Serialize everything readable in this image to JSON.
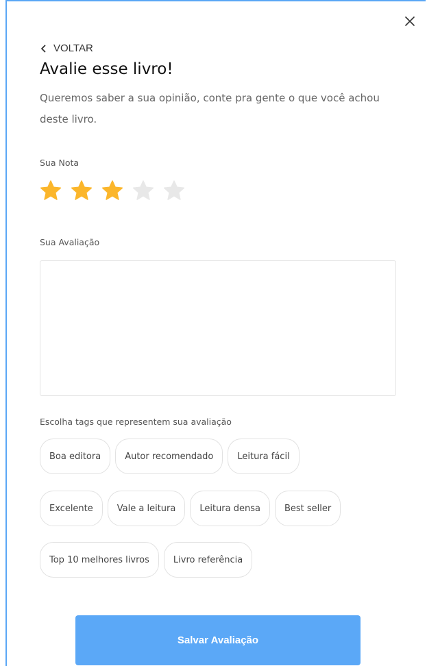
{
  "header": {
    "back_label": "VOLTAR",
    "title": "Avalie esse livro!",
    "subtitle": "Queremos saber a sua opinião, conte pra gente o que você achou deste livro."
  },
  "rating": {
    "label": "Sua Nota",
    "value": 3,
    "max": 5,
    "filled_color": "#fbb62b",
    "empty_color": "#e8e8e8"
  },
  "review": {
    "label": "Sua Avaliação",
    "value": "",
    "placeholder": ""
  },
  "tags": {
    "label": "Escolha tags que representem sua avaliação",
    "rows": [
      [
        "Boa editora",
        "Autor recomendado",
        "Leitura fácil"
      ],
      [
        "Excelente",
        "Vale a leitura",
        "Leitura densa",
        "Best seller"
      ],
      [
        "Top 10 melhores livros",
        "Livro referência"
      ]
    ]
  },
  "actions": {
    "save_label": "Salvar Avaliação",
    "accent_color": "#5ba8f7"
  }
}
